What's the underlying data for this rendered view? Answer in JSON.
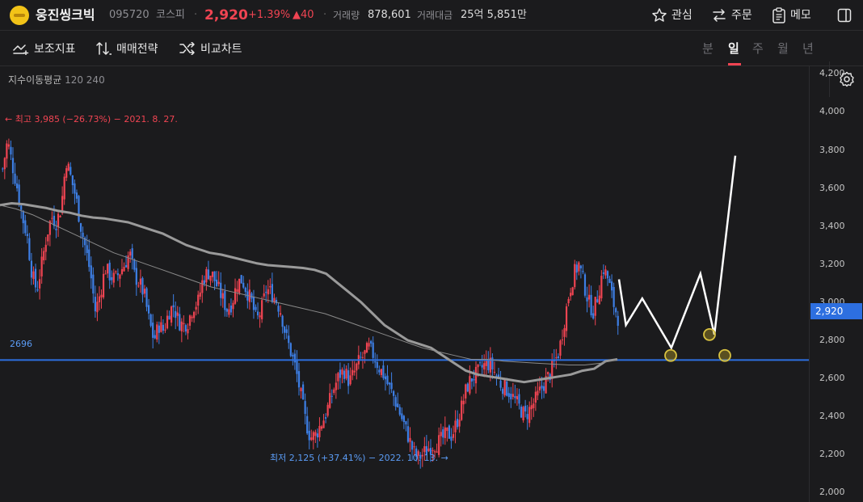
{
  "header": {
    "stock_name": "웅진씽크빅",
    "code": "095720",
    "market": "코스피",
    "separator": "·",
    "price": "2,920",
    "change_pct": "+1.39%",
    "change_abs": "▲40",
    "volume_label": "거래량",
    "volume": "878,601",
    "amount_label": "거래대금",
    "amount": "25억 5,851만",
    "actions": {
      "watch": "관심",
      "order": "주문",
      "memo": "메모"
    }
  },
  "toolbar": {
    "indicators": "보조지표",
    "strategy": "매매전략",
    "compare": "비교차트",
    "periods": [
      "분",
      "일",
      "주",
      "월",
      "년"
    ],
    "active_period": "일"
  },
  "ma_label": {
    "title": "지수이동평균",
    "values": "120 240"
  },
  "annotations": {
    "high": "← 최고 3,985 (−26.73%) − 2021. 8. 27.",
    "low": "최저 2,125 (+37.41%) − 2022. 10. 13. →",
    "level": "2696"
  },
  "colors": {
    "up": "#f04452",
    "down": "#3d7fe6",
    "level_line": "#2d6fe0",
    "ma120": "#9a9a9a",
    "ma240": "#8a8a8a"
  },
  "chart_data": {
    "type": "candlestick",
    "y_ticks": [
      "4,200",
      "4,000",
      "3,800",
      "3,600",
      "3,400",
      "3,200",
      "3,000",
      "2,800",
      "2,600",
      "2,400",
      "2,200",
      "2,000"
    ],
    "ylim": [
      1950,
      4240
    ],
    "current_price": "2,920",
    "current_price_value": 2920,
    "horizontal_level": 2696,
    "high": 3985,
    "low": 2125,
    "close_path": [
      3700,
      3850,
      3720,
      3600,
      3450,
      3350,
      3150,
      3060,
      3200,
      3350,
      3450,
      3420,
      3500,
      3750,
      3650,
      3550,
      3400,
      3280,
      3150,
      2950,
      3050,
      3180,
      3140,
      3120,
      3160,
      3200,
      3260,
      3140,
      3100,
      3040,
      2900,
      2800,
      2880,
      2850,
      2950,
      2980,
      2900,
      2880,
      2900,
      2980,
      3000,
      3120,
      3160,
      3140,
      3080,
      3020,
      2960,
      3000,
      3100,
      3120,
      3060,
      3000,
      2900,
      2960,
      3070,
      3050,
      3010,
      2950,
      2820,
      2740,
      2650,
      2520,
      2380,
      2290,
      2300,
      2350,
      2400,
      2480,
      2560,
      2620,
      2640,
      2580,
      2630,
      2690,
      2720,
      2760,
      2720,
      2660,
      2620,
      2560,
      2510,
      2440,
      2370,
      2300,
      2220,
      2180,
      2200,
      2230,
      2250,
      2260,
      2280,
      2310,
      2300,
      2370,
      2450,
      2550,
      2600,
      2620,
      2650,
      2680,
      2670,
      2620,
      2570,
      2550,
      2520,
      2480,
      2440,
      2400,
      2440,
      2480,
      2530,
      2580,
      2620,
      2680,
      2750,
      2900,
      3050,
      3150,
      3200,
      3100,
      3000,
      2950,
      3050,
      3180,
      3120,
      3000,
      2920
    ],
    "ema120_path": [
      3510,
      3520,
      3515,
      3505,
      3495,
      3480,
      3470,
      3455,
      3445,
      3440,
      3430,
      3420,
      3400,
      3380,
      3360,
      3330,
      3300,
      3280,
      3260,
      3250,
      3235,
      3220,
      3205,
      3195,
      3190,
      3185,
      3180,
      3170,
      3150,
      3100,
      3050,
      3000,
      2940,
      2880,
      2840,
      2800,
      2780,
      2760,
      2720,
      2680,
      2640,
      2620,
      2610,
      2600,
      2590,
      2580,
      2590,
      2600,
      2610,
      2620,
      2640,
      2650,
      2690,
      2700
    ],
    "ema240_path": [
      3510,
      3490,
      3460,
      3420,
      3380,
      3340,
      3300,
      3260,
      3230,
      3200,
      3170,
      3140,
      3110,
      3080,
      3060,
      3040,
      3020,
      3000,
      2980,
      2960,
      2940,
      2910,
      2880,
      2850,
      2820,
      2790,
      2760,
      2740,
      2720,
      2700,
      2700,
      2690,
      2685,
      2680,
      2675,
      2670,
      2670,
      2680,
      2700
    ],
    "drawn_path": [
      [
        0.0,
        3120
      ],
      [
        0.06,
        2880
      ],
      [
        0.2,
        3020
      ],
      [
        0.45,
        2760
      ],
      [
        0.7,
        3150
      ],
      [
        0.82,
        2830
      ],
      [
        1.0,
        3770
      ]
    ],
    "circles": [
      2720,
      2830,
      2720
    ]
  }
}
